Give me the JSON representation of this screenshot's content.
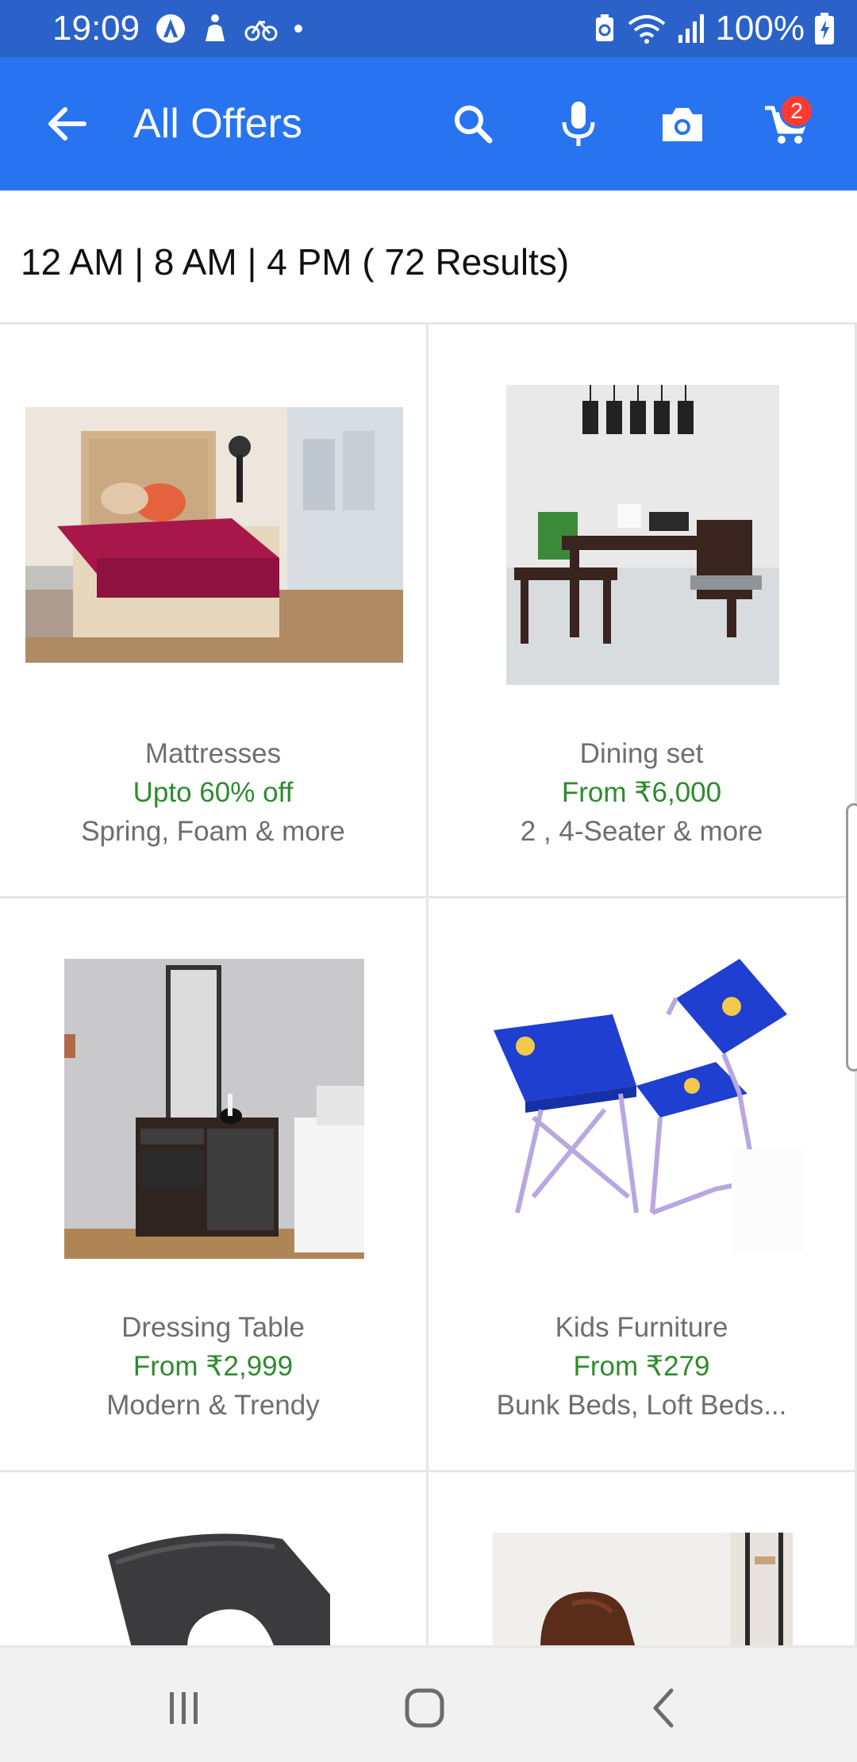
{
  "status_bar": {
    "time": "19:09",
    "left_icons": [
      "assistant-icon",
      "accessibility-icon",
      "cycling-icon",
      "dot-icon"
    ],
    "right_icons": [
      "battery-saver-icon",
      "wifi-icon",
      "signal-icon",
      "battery-charging-icon"
    ],
    "battery": "100%"
  },
  "app_bar": {
    "title": "All Offers",
    "cart_count": "2",
    "color": "#2874f0"
  },
  "results": {
    "text": "12 AM | 8 AM | 4 PM ( 72 Results)"
  },
  "offers": [
    {
      "name": "Mattresses",
      "offer": "Upto 60% off",
      "sub": "Spring, Foam & more",
      "image": "mattress-image"
    },
    {
      "name": "Dining set",
      "offer": "From ₹6,000",
      "sub": "2 , 4-Seater & more",
      "image": "dining-set-image"
    },
    {
      "name": "Dressing Table",
      "offer": "From ₹2,999",
      "sub": "Modern & Trendy",
      "image": "dressing-table-image"
    },
    {
      "name": "Kids Furniture",
      "offer": "From ₹279",
      "sub": "Bunk Beds, Loft Beds...",
      "image": "kids-furniture-image"
    },
    {
      "name": "",
      "offer": "",
      "sub": "",
      "image": "chair-image"
    },
    {
      "name": "",
      "offer": "",
      "sub": "",
      "image": "recliner-image"
    }
  ],
  "nav_bar": {
    "buttons": [
      "recent-apps",
      "home",
      "back"
    ]
  },
  "colors": {
    "status_bar": "#2b62c9",
    "offer_green": "#2e8b2e",
    "badge_red": "#ff3b30"
  }
}
